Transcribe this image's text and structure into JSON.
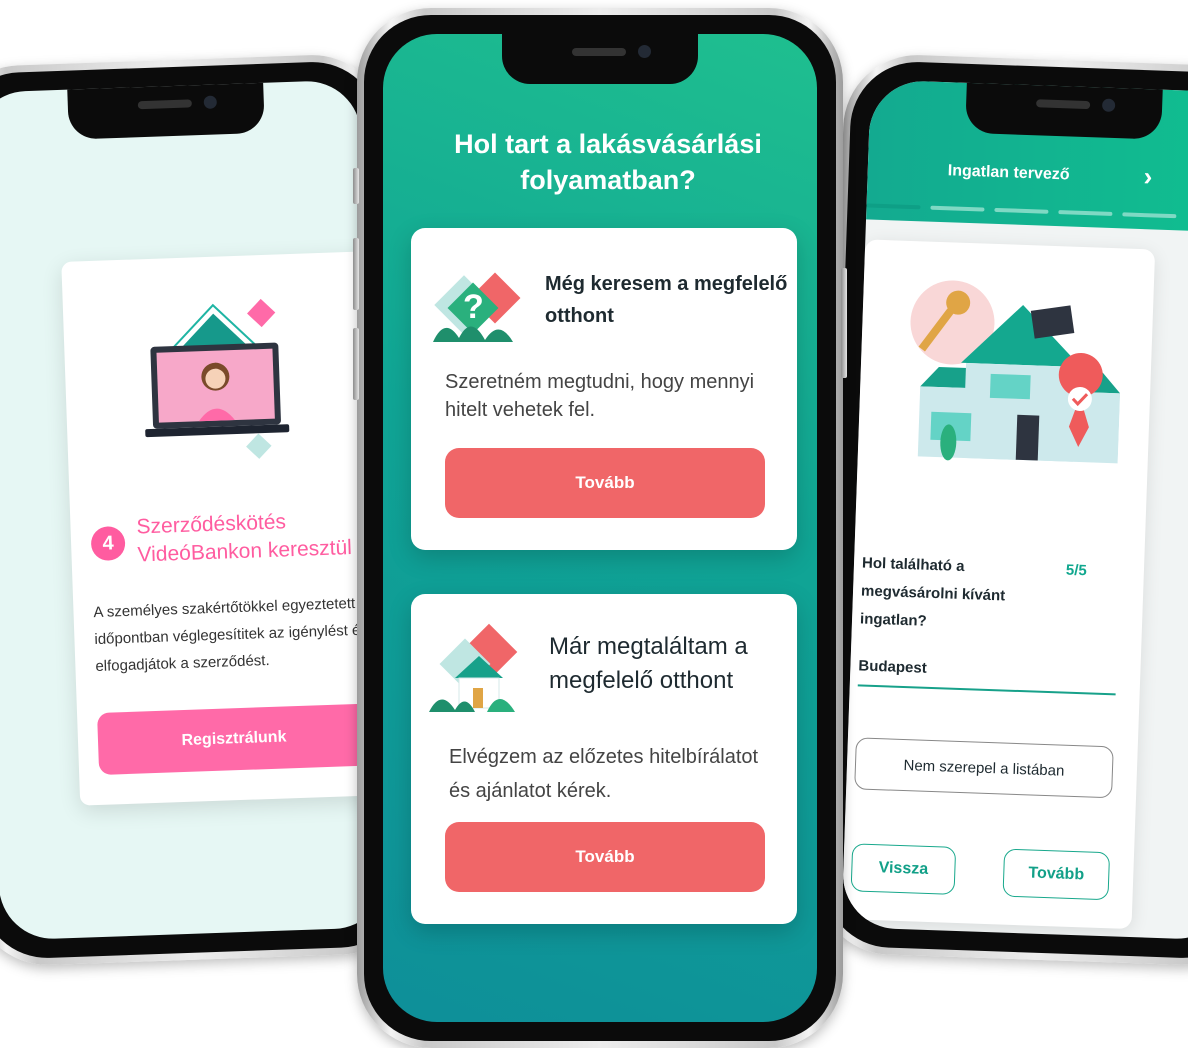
{
  "left_screen": {
    "step_number": "4",
    "step_title": "Szerződéskötés VideóBankon keresztül",
    "description": "A személyes szakértőtökkel egyeztetett időpontban véglegesítitek az igénylést és elfogadjátok a szerződést.",
    "button_label": "Regisztrálunk"
  },
  "center_screen": {
    "title": "Hol tart a lakásvásárlási folyamatban?",
    "cards": [
      {
        "title": "Még keresem a megfelelő otthont",
        "description": "Szeretném megtudni, hogy mennyi hitelt vehetek fel.",
        "button_label": "Tovább"
      },
      {
        "title": "Már megtaláltam a megfelelő otthont",
        "description": "Elvégzem az előzetes hitelbírálatot és ajánlatot kérek.",
        "button_label": "Tovább"
      }
    ]
  },
  "right_screen": {
    "header_title": "Ingatlan tervező",
    "question": "Hol található a megvásárolni kívánt ingatlan?",
    "counter": "5/5",
    "location_value": "Budapest",
    "not_listed_label": "Nem szerepel a listában",
    "back_label": "Vissza",
    "next_label": "Tovább",
    "progress_steps": 5,
    "progress_active": 1
  },
  "colors": {
    "brand_pink": "#ff5ca0",
    "brand_coral": "#f06668",
    "brand_teal": "#12a088",
    "brand_green": "#10c090"
  },
  "icons": [
    "chevron-right-icon",
    "video-call-illustration",
    "question-house-illustration",
    "house-illustration",
    "house-key-illustration"
  ]
}
